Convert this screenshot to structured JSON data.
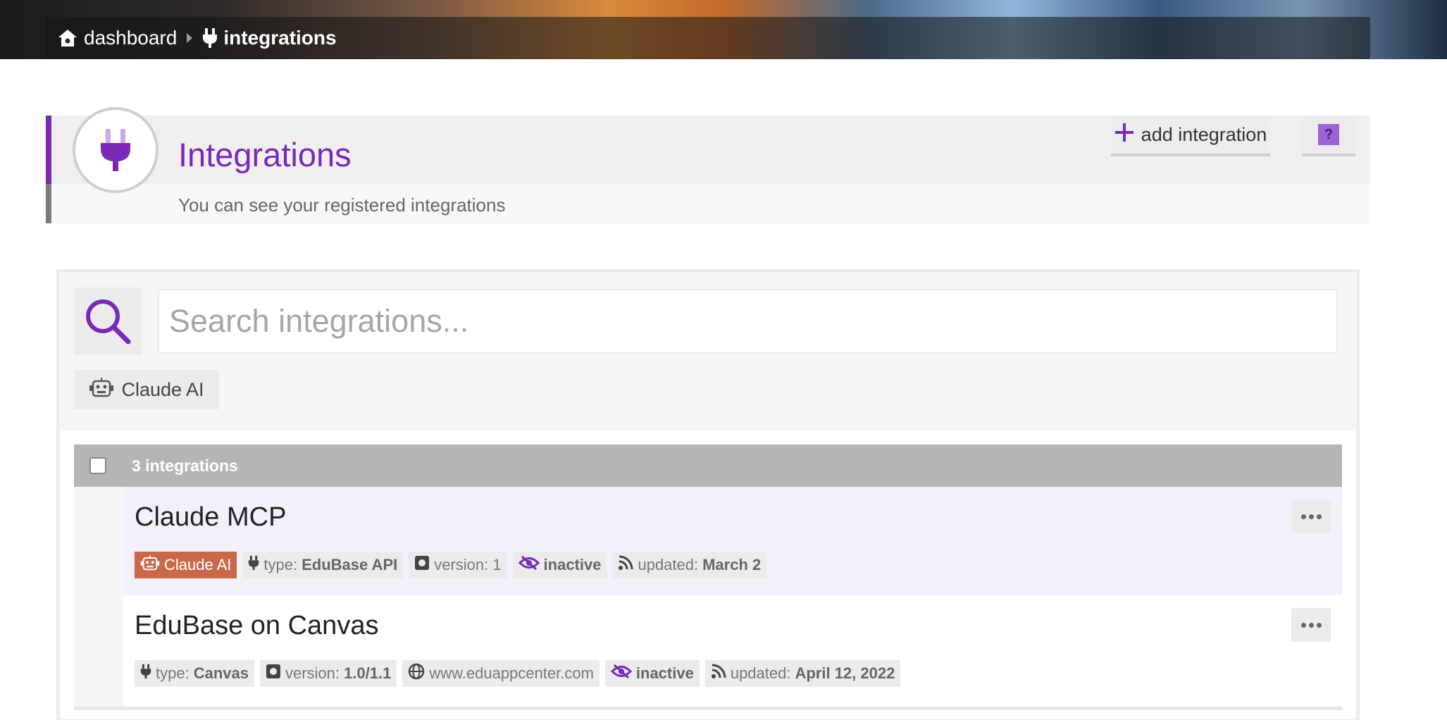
{
  "breadcrumb": {
    "home_label": "dashboard",
    "current_label": "integrations"
  },
  "header": {
    "title": "Integrations",
    "subtitle": "You can see your registered integrations",
    "add_button_label": "add integration",
    "help_button_label": "?"
  },
  "search": {
    "placeholder": "Search integrations...",
    "value": ""
  },
  "filters": {
    "chip_label": "Claude AI"
  },
  "list": {
    "count_label": "3 integrations",
    "items": [
      {
        "name": "Claude MCP",
        "tags": {
          "badge": "Claude AI",
          "type_prefix": "type:",
          "type_value": "EduBase API",
          "version_prefix": "version:",
          "version_value": "1",
          "status": "inactive",
          "updated_prefix": "updated:",
          "updated_value": "March 2"
        }
      },
      {
        "name": "EduBase on Canvas",
        "tags": {
          "type_prefix": "type:",
          "type_value": "Canvas",
          "version_prefix": "version:",
          "version_value": "1.0/1.1",
          "site": "www.eduappcenter.com",
          "status": "inactive",
          "updated_prefix": "updated:",
          "updated_value": "April 12, 2022"
        }
      }
    ]
  },
  "colors": {
    "accent": "#7a29b6",
    "badge_claude": "#c9694a",
    "list_header": "#b5b5b5",
    "row_highlight": "#f4f0fb"
  },
  "icons": {
    "home": "home-icon",
    "plug": "plug-icon",
    "search": "search-icon",
    "robot": "robot-icon",
    "plus": "plus-icon",
    "version": "version-icon",
    "eye_slash": "eye-slash-icon",
    "feed": "feed-icon",
    "globe": "globe-icon",
    "ellipsis": "ellipsis-icon"
  }
}
